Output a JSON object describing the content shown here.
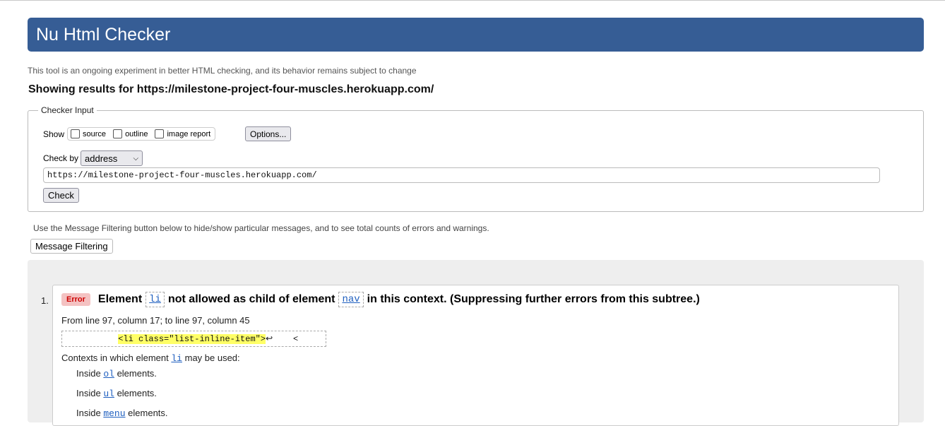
{
  "header": {
    "title": "Nu Html Checker"
  },
  "tagline": "This tool is an ongoing experiment in better HTML checking, and its behavior remains subject to change",
  "results_heading": "Showing results for https://milestone-project-four-muscles.herokuapp.com/",
  "checker_input": {
    "legend": "Checker Input",
    "show_label": "Show",
    "checkboxes": [
      {
        "label": "source",
        "checked": false
      },
      {
        "label": "outline",
        "checked": false
      },
      {
        "label": "image report",
        "checked": false
      }
    ],
    "options_label": "Options...",
    "check_by_label": "Check by",
    "check_by_value": "address",
    "url_value": "https://milestone-project-four-muscles.herokuapp.com/",
    "check_label": "Check"
  },
  "filter": {
    "hint": "Use the Message Filtering button below to hide/show particular messages, and to see total counts of errors and warnings.",
    "button_label": "Message Filtering"
  },
  "messages": [
    {
      "number": "1.",
      "type": "Error",
      "title_part1": "Element",
      "element": "li",
      "title_part2": "not allowed as child of element",
      "parent": "nav",
      "title_part3": "in this context. (Suppressing further errors from this subtree.)",
      "location": "From line 97, column 17; to line 97, column 45",
      "extract_code": "<li class=\"list-inline-item\">",
      "extract_return": "↩",
      "extract_tail": "<",
      "contexts_intro": "Contexts in which element",
      "contexts_element": "li",
      "contexts_outro": "may be used:",
      "contexts": [
        {
          "prefix": "Inside",
          "code": "ol",
          "suffix": "elements."
        },
        {
          "prefix": "Inside",
          "code": "ul",
          "suffix": "elements."
        },
        {
          "prefix": "Inside",
          "code": "menu",
          "suffix": "elements."
        }
      ]
    }
  ],
  "colors": {
    "header_bg": "#365d95",
    "error_badge_bg": "#f4c2c2",
    "error_badge_text": "#cc0000",
    "highlight": "#ffff66",
    "link": "#1f5fbf"
  }
}
